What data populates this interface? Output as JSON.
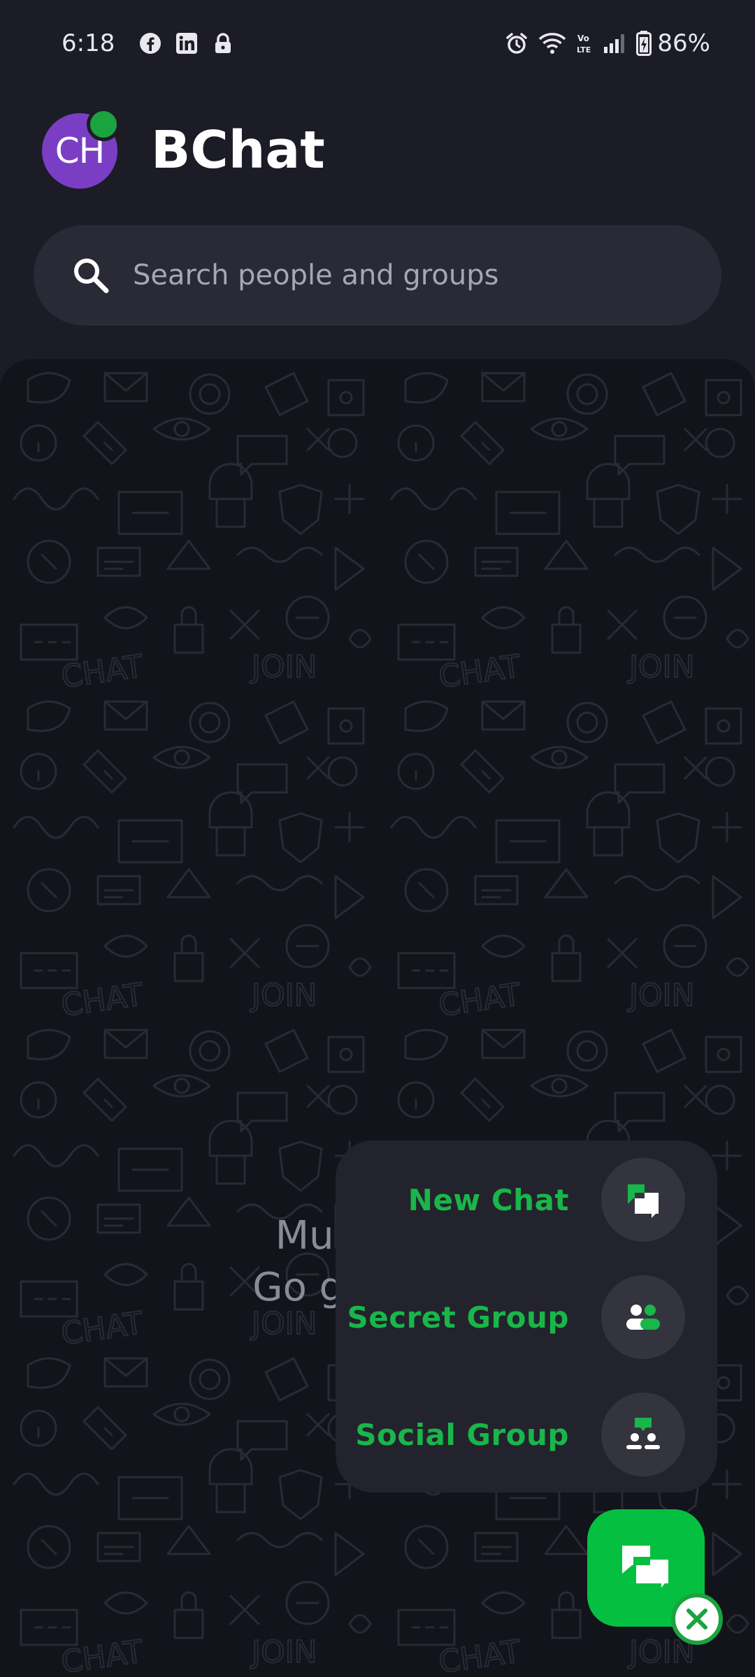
{
  "status_bar": {
    "time": "6:18",
    "left_icons": [
      "facebook-icon",
      "linkedin-icon",
      "lock-icon"
    ],
    "right_icons": [
      "alarm-icon",
      "wifi-icon",
      "volte-icon",
      "signal-icon",
      "battery-charging-icon"
    ],
    "battery": "86%"
  },
  "header": {
    "avatar_initials": "CH",
    "title": "BChat",
    "online": true
  },
  "search": {
    "placeholder": "Search people and groups"
  },
  "empty_state": {
    "line1": "Much emp",
    "line2": "Go get some"
  },
  "fab_menu": {
    "items": [
      {
        "label": "New Chat",
        "icon": "new-chat-icon"
      },
      {
        "label": "Secret Group",
        "icon": "secret-group-icon"
      },
      {
        "label": "Social Group",
        "icon": "social-group-icon"
      }
    ]
  },
  "fab": {
    "icon": "chat-bubbles-icon",
    "close_icon": "close-icon"
  },
  "colors": {
    "accent": "#05c040",
    "accent_text": "#19b64a",
    "background": "#1c1c26",
    "avatar": "#7a3ec4"
  }
}
